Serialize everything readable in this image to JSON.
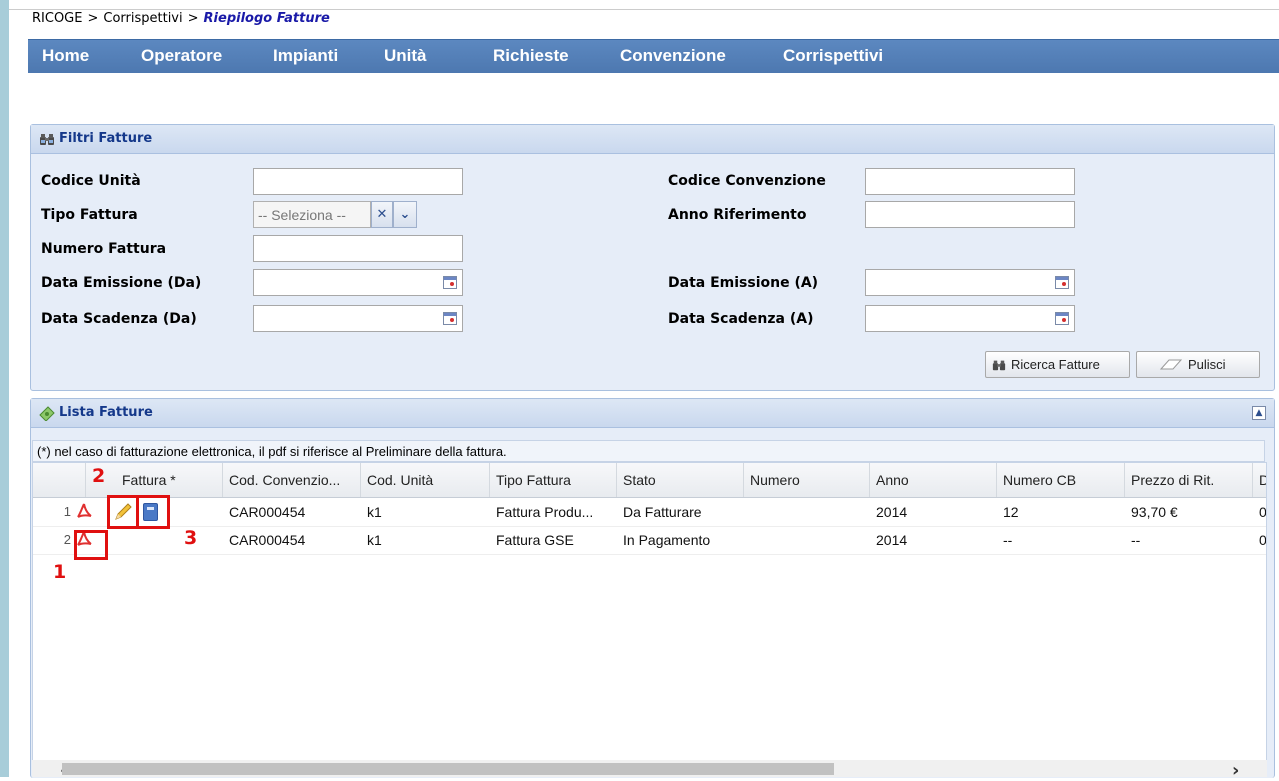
{
  "breadcrumb": {
    "root": "RICOGE",
    "separator": ">",
    "section": "Corrispettivi",
    "current": "Riepilogo Fatture"
  },
  "nav": {
    "items": [
      {
        "label": "Home"
      },
      {
        "label": "Operatore"
      },
      {
        "label": "Impianti"
      },
      {
        "label": "Unità"
      },
      {
        "label": "Richieste"
      },
      {
        "label": "Convenzione"
      },
      {
        "label": "Corrispettivi"
      }
    ]
  },
  "filters": {
    "title": "Filtri Fatture",
    "codice_unita": {
      "label": "Codice Unità",
      "value": ""
    },
    "codice_convenzione": {
      "label": "Codice Convenzione",
      "value": ""
    },
    "tipo_fattura": {
      "label": "Tipo Fattura",
      "placeholder": "-- Seleziona --"
    },
    "anno_riferimento": {
      "label": "Anno Riferimento",
      "value": ""
    },
    "numero_fattura": {
      "label": "Numero Fattura",
      "value": ""
    },
    "data_emissione_da": {
      "label": "Data Emissione (Da)",
      "value": ""
    },
    "data_emissione_a": {
      "label": "Data Emissione (A)",
      "value": ""
    },
    "data_scadenza_da": {
      "label": "Data Scadenza (Da)",
      "value": ""
    },
    "data_scadenza_a": {
      "label": "Data Scadenza (A)",
      "value": ""
    },
    "search_button": "Ricerca Fatture",
    "clear_button": "Pulisci"
  },
  "list": {
    "title": "Lista Fatture",
    "note": "(*) nel caso di fatturazione elettronica, il pdf si riferisce al Preliminare della fattura.",
    "columns": [
      "Fattura *",
      "Cod. Convenzio...",
      "Cod. Unità",
      "Tipo Fattura",
      "Stato",
      "Numero",
      "Anno",
      "Numero CB",
      "Prezzo di Rit.",
      "D"
    ],
    "rows": [
      {
        "num": "1",
        "cod_convenzione": "CAR000454",
        "cod_unita": "k1",
        "tipo_fattura": "Fattura Produ...",
        "stato": "Da Fatturare",
        "numero": "",
        "anno": "2014",
        "numero_cb": "12",
        "prezzo": "93,70 €",
        "d": "0"
      },
      {
        "num": "2",
        "cod_convenzione": "CAR000454",
        "cod_unita": "k1",
        "tipo_fattura": "Fattura GSE",
        "stato": "In Pagamento",
        "numero": "",
        "anno": "2014",
        "numero_cb": "--",
        "prezzo": "--",
        "d": "0"
      }
    ]
  },
  "callouts": {
    "one": "1",
    "two": "2",
    "three": "3"
  },
  "colors": {
    "nav": "#4d78b0",
    "panel_title": "#14388a",
    "breadcrumb_current": "#1a1aa8",
    "callout": "#e01010"
  }
}
